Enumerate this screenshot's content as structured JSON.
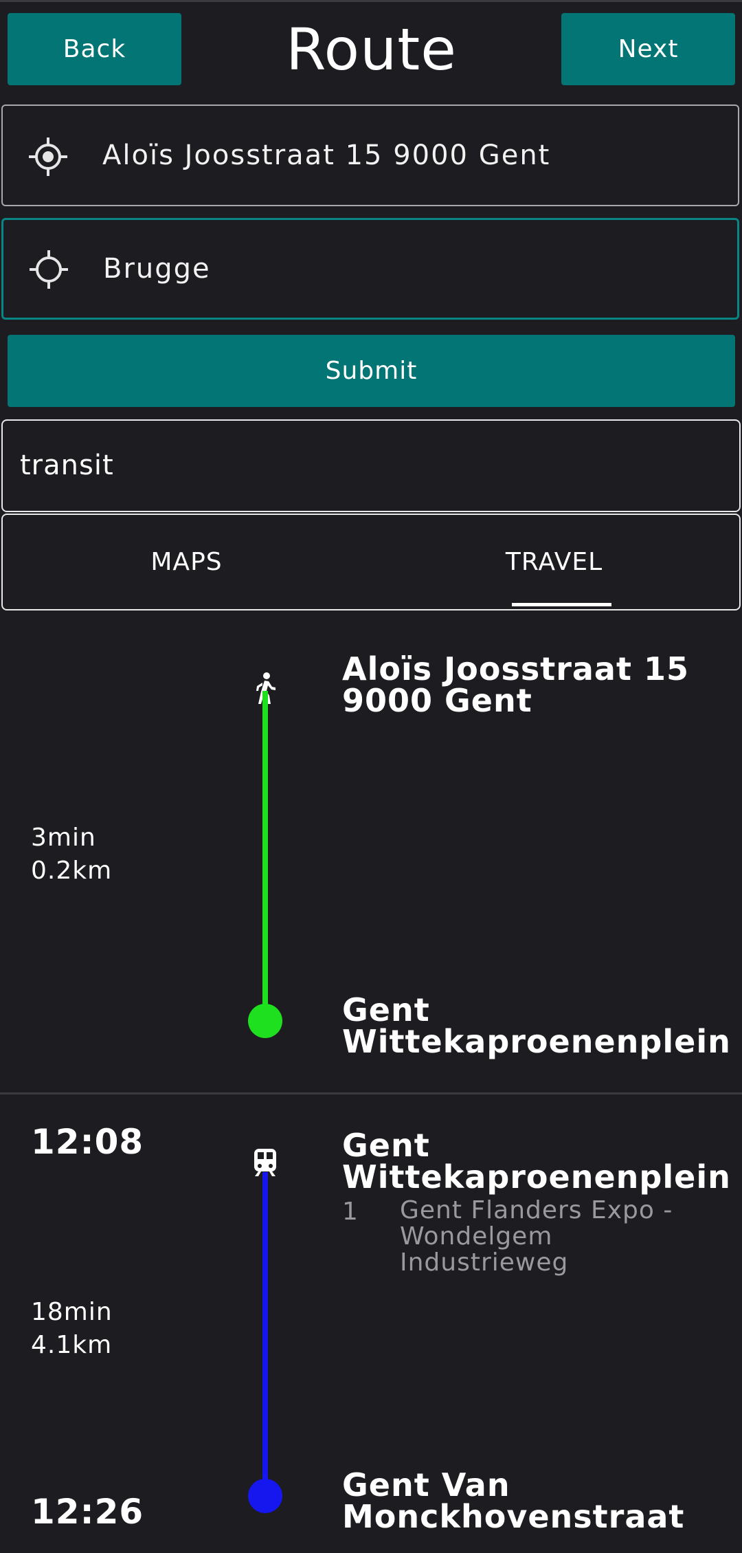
{
  "header": {
    "back_label": "Back",
    "title": "Route",
    "next_label": "Next"
  },
  "origin": {
    "value": "Aloïs Joosstraat 15 9000 Gent",
    "icon": "my-location-icon"
  },
  "destination": {
    "value": "Brugge",
    "icon": "location-target-icon"
  },
  "submit_label": "Submit",
  "mode": "transit",
  "tabs": [
    {
      "label": "MAPS",
      "selected": false
    },
    {
      "label": "TRAVEL",
      "selected": true
    }
  ],
  "segments": [
    {
      "type": "walk",
      "icon": "walk-icon",
      "color": "#1ee01e",
      "from": "Aloïs Joosstraat 15 9000 Gent",
      "to": "Gent Wittekaproenenplein",
      "duration": "3min",
      "distance": "0.2km"
    },
    {
      "type": "transit",
      "icon": "tram-icon",
      "color": "#1616ee",
      "from": "Gent Wittekaproenenplein",
      "to": "Gent Van Monckhovenstraat",
      "depart_time": "12:08",
      "arrive_time": "12:26",
      "line_number": "1",
      "line_destination": "Gent Flanders Expo - Wondelgem Industrieweg",
      "duration": "18min",
      "distance": "4.1km"
    }
  ],
  "colors": {
    "accent": "#037575",
    "background": "#1c1c21"
  }
}
